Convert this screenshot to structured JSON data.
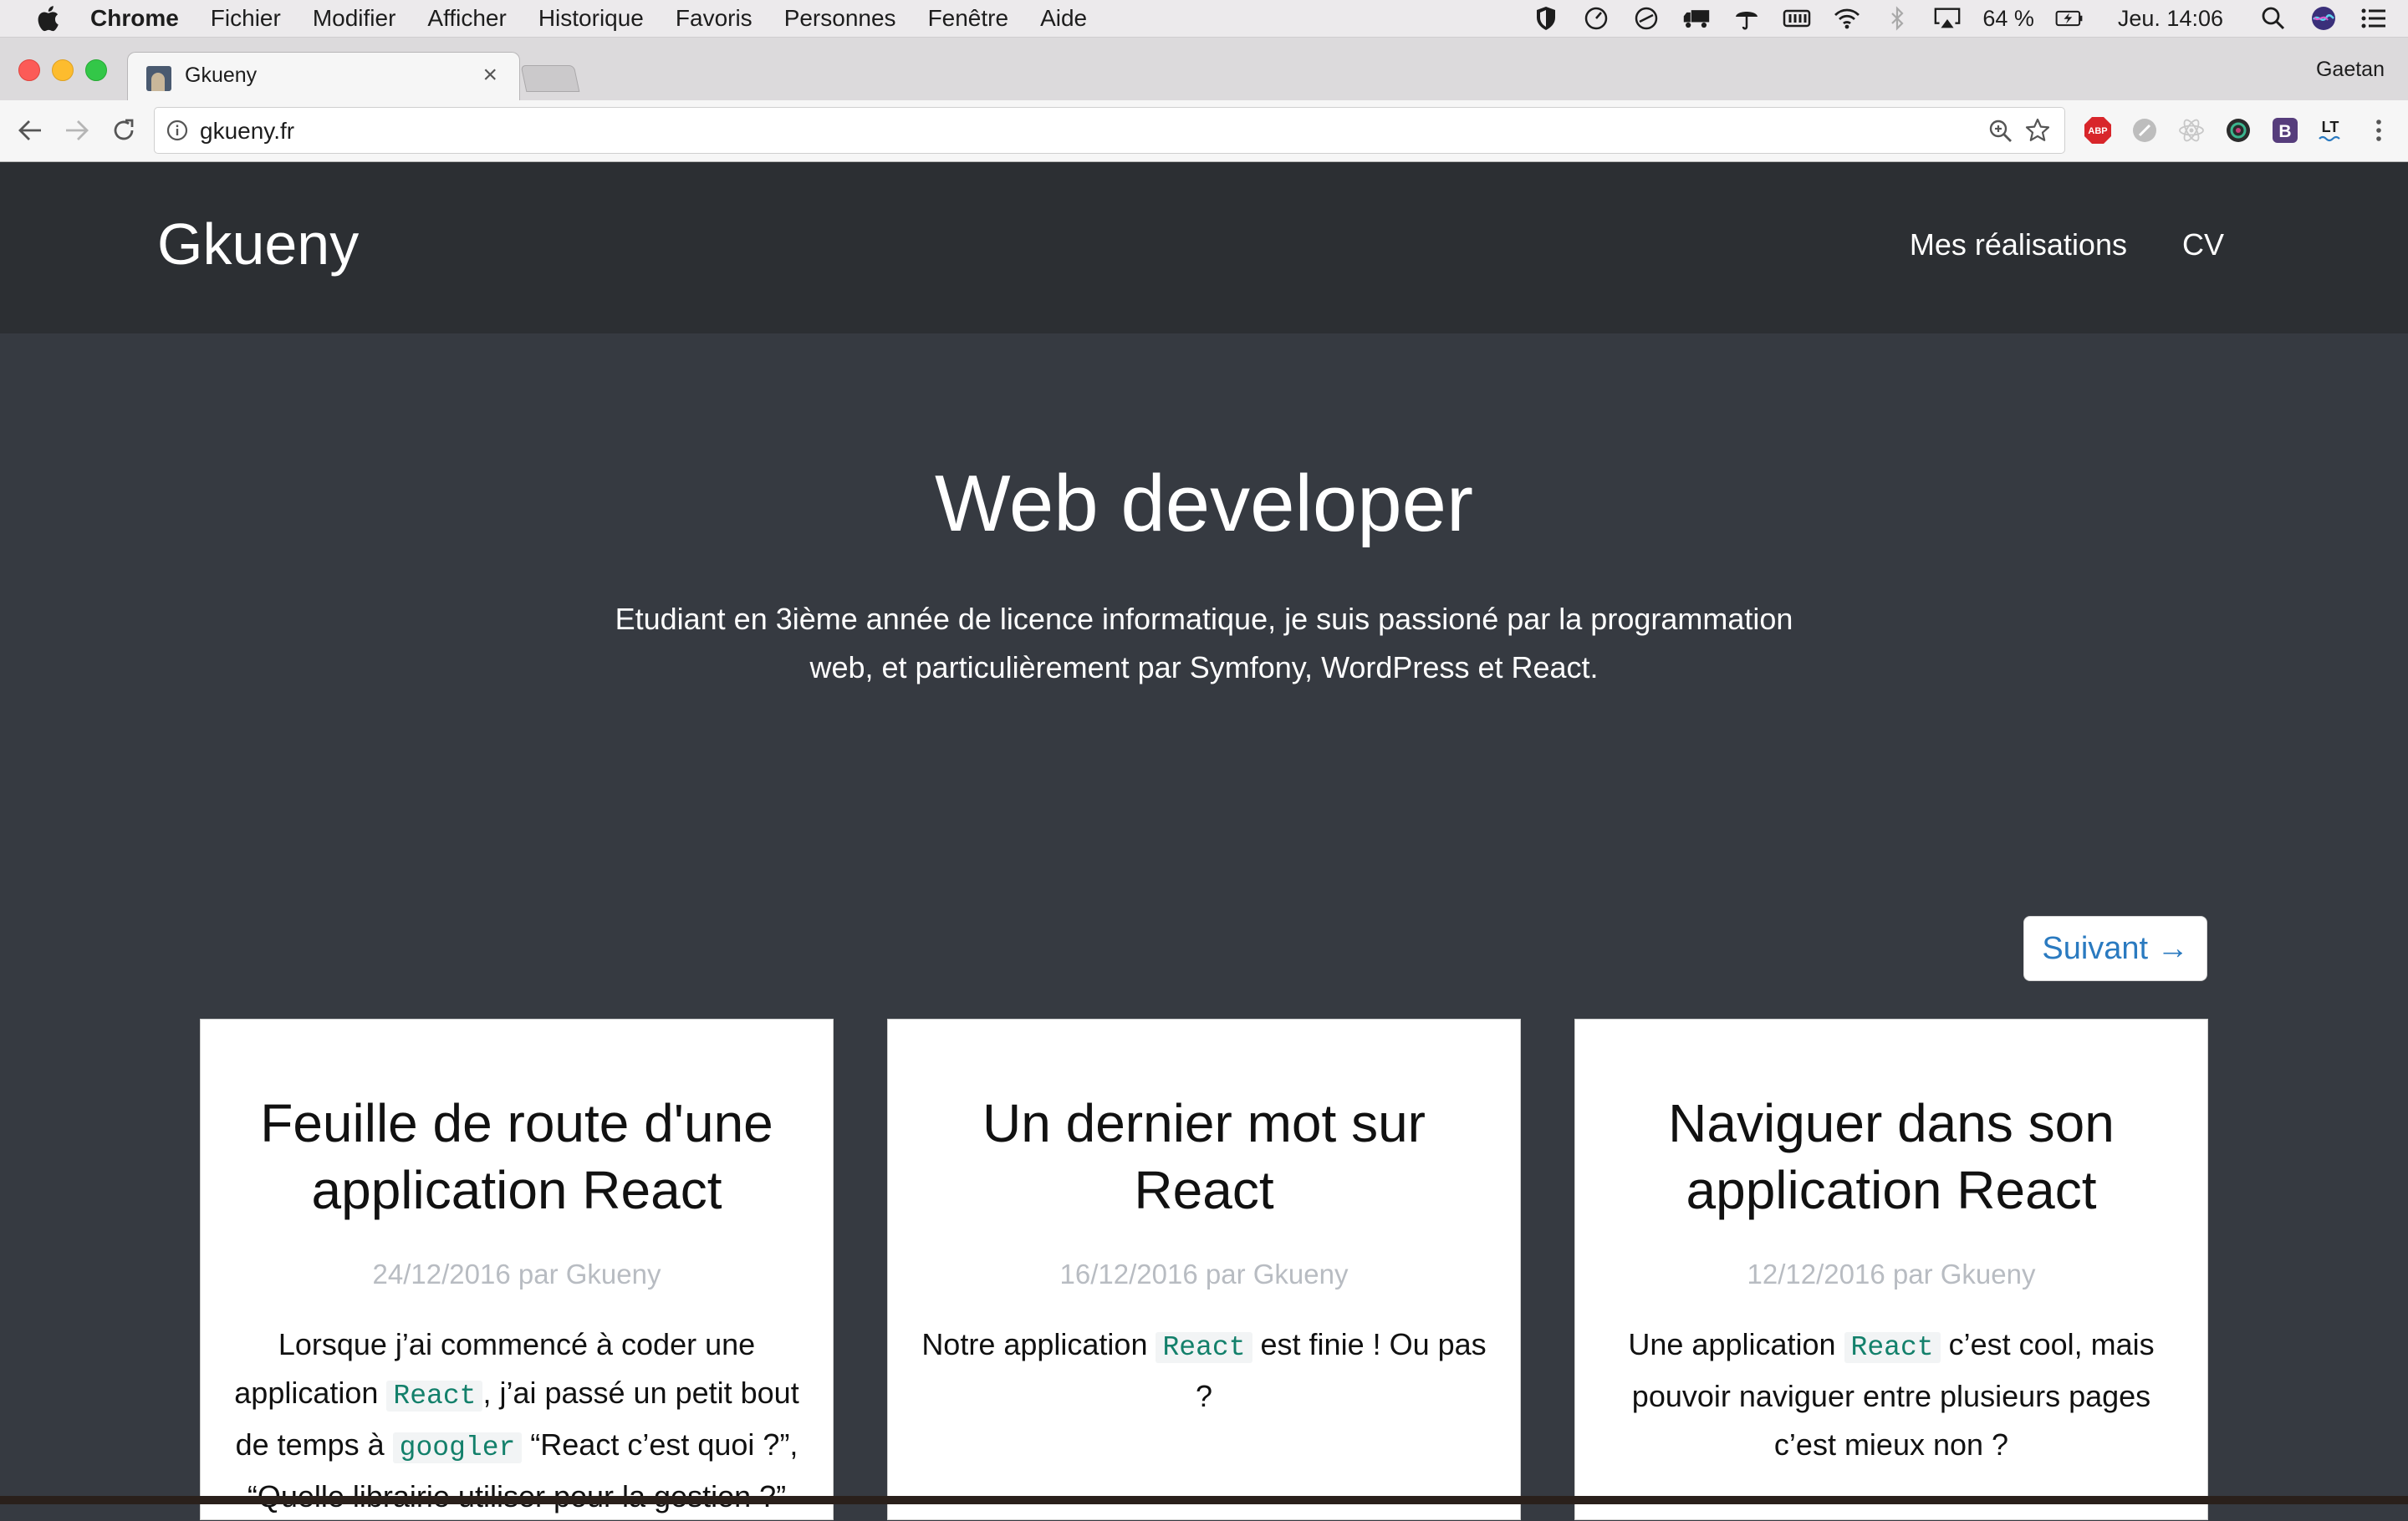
{
  "menubar": {
    "app": "Chrome",
    "items": [
      "Fichier",
      "Modifier",
      "Afficher",
      "Historique",
      "Favoris",
      "Personnes",
      "Fenêtre",
      "Aide"
    ],
    "battery": "64 %",
    "clock": "Jeu. 14:06"
  },
  "browser": {
    "tab_title": "Gkueny",
    "tab_close": "×",
    "profile": "Gaetan",
    "url": "gkueny.fr"
  },
  "site": {
    "brand": "Gkueny",
    "nav": [
      "Mes réalisations",
      "CV"
    ],
    "hero_title": "Web developer",
    "hero_desc": "Etudiant en 3ième année de licence informatique, je suis passioné par la programmation web, et particulièrement par Symfony, WordPress et React.",
    "next_label": "Suivant →",
    "posts": [
      {
        "title": "Feuille de route d'une application React",
        "meta": "24/12/2016 par Gkueny",
        "excerpt_1": "Lorsque j’ai commencé à coder une application ",
        "code_1": "React",
        "excerpt_2": ", j’ai passé un petit bout de temps à ",
        "code_2": "googler",
        "excerpt_3": " “React c’est quoi ?”, “Quelle librairie utiliser pour la gestion ?”"
      },
      {
        "title": "Un dernier mot sur React",
        "meta": "16/12/2016 par Gkueny",
        "excerpt_1": "Notre application ",
        "code_1": "React",
        "excerpt_2": " est finie ! Ou pas ?"
      },
      {
        "title": "Naviguer dans son application React",
        "meta": "12/12/2016 par Gkueny",
        "excerpt_1": "Une application ",
        "code_1": "React",
        "excerpt_2": " c’est cool, mais pouvoir naviguer entre plusieurs pages c’est mieux non ?"
      }
    ]
  },
  "colors": {
    "header_bg": "#2c2f33",
    "page_bg": "#363a41",
    "link_blue": "#2a7ac0",
    "code_green": "#13806b"
  }
}
